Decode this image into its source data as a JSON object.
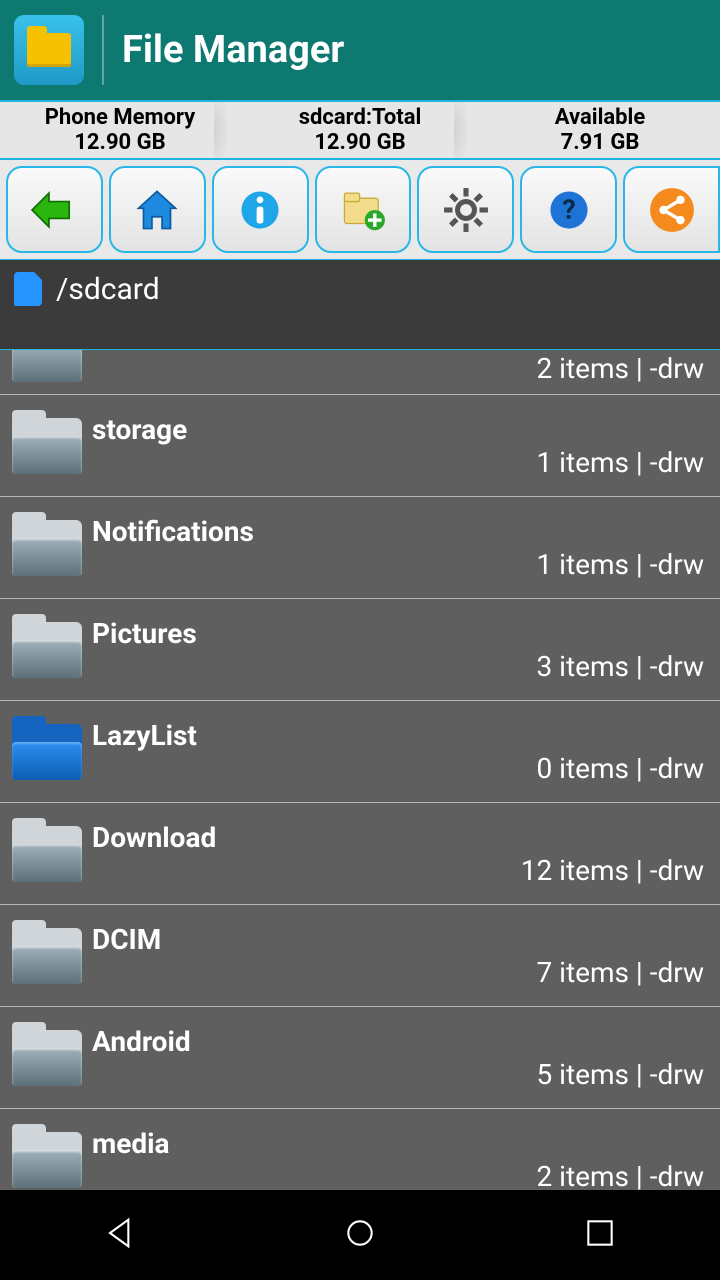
{
  "app": {
    "title": "File Manager"
  },
  "stats": [
    {
      "label": "Phone Memory",
      "value": "12.90 GB"
    },
    {
      "label": "sdcard:Total",
      "value": "12.90 GB"
    },
    {
      "label": "Available",
      "value": "7.91 GB"
    }
  ],
  "path": "/sdcard",
  "folders": [
    {
      "name": "",
      "meta": "2 items | -drw",
      "icon": "metal",
      "partial": true
    },
    {
      "name": "storage",
      "meta": "1 items | -drw",
      "icon": "metal"
    },
    {
      "name": "Notifications",
      "meta": "1 items | -drw",
      "icon": "metal"
    },
    {
      "name": "Pictures",
      "meta": "3 items | -drw",
      "icon": "metal"
    },
    {
      "name": "LazyList",
      "meta": "0 items | -drw",
      "icon": "blue"
    },
    {
      "name": "Download",
      "meta": "12 items | -drw",
      "icon": "metal"
    },
    {
      "name": "DCIM",
      "meta": "7 items | -drw",
      "icon": "metal"
    },
    {
      "name": "Android",
      "meta": "5 items | -drw",
      "icon": "metal"
    },
    {
      "name": "media",
      "meta": "2 items | -drw",
      "icon": "metal"
    }
  ]
}
